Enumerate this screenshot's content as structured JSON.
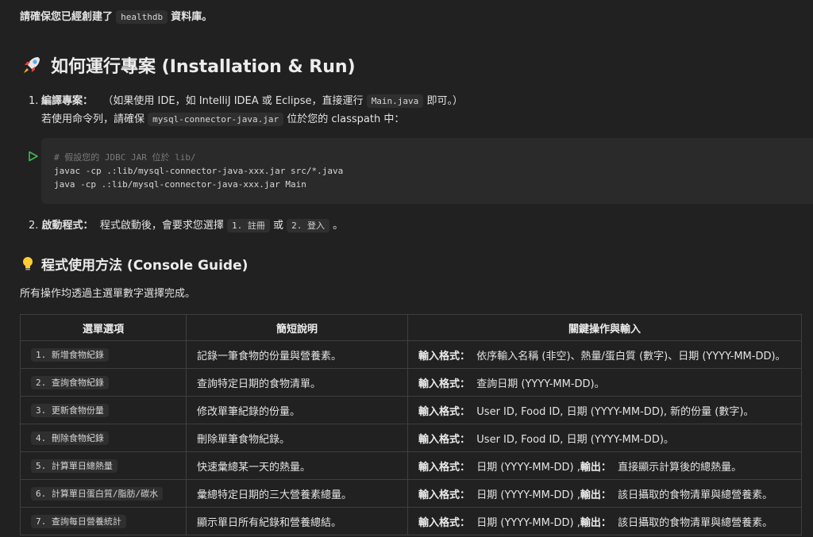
{
  "top": {
    "prefix": "請確保您已經創建了",
    "code": "healthdb",
    "suffix": "資料庫。"
  },
  "install": {
    "heading": "如何運行專案 (Installation & Run)",
    "icon": "rocket-icon",
    "step1": {
      "num": "1.",
      "label": "編譯專案：",
      "text_a": "（如果使用 IDE，如 IntelliJ IDEA 或 Eclipse，直接運行",
      "code_a": "Main.java",
      "text_b": "即可。）",
      "text_c": "若使用命令列，請確保",
      "code_b": "mysql-connector-java.jar",
      "text_d": "位於您的 classpath 中："
    },
    "code_block": {
      "comment": "# 假設您的 JDBC JAR 位於 lib/",
      "line1": "javac -cp .:lib/mysql-connector-java-xxx.jar src/*.java",
      "line2": "java -cp .:lib/mysql-connector-java-xxx.jar Main",
      "run_icon": "run-icon"
    },
    "step2": {
      "num": "2.",
      "label": "啟動程式：",
      "text_a": "程式啟動後，會要求您選擇",
      "code_a": "1. 註冊",
      "text_b": "或",
      "code_b": "2. 登入",
      "text_c": "。"
    }
  },
  "guide": {
    "heading": "程式使用方法 (Console Guide)",
    "icon": "lightbulb-icon",
    "desc": "所有操作均透過主選單數字選擇完成。",
    "headers": [
      "選單選項",
      "簡短說明",
      "關鍵操作與輸入"
    ],
    "rows": [
      {
        "option": "1. 新增食物紀錄",
        "desc": "記錄一筆食物的份量與營養素。",
        "in_label": "輸入格式：",
        "in_text": "依序輸入名稱 (非空)、熱量/蛋白質 (數字)、日期 (YYYY-MM-DD)。",
        "out_label": "",
        "out_text": ""
      },
      {
        "option": "2. 查詢食物紀錄",
        "desc": "查詢特定日期的食物清單。",
        "in_label": "輸入格式：",
        "in_text": "查詢日期 (YYYY-MM-DD)。",
        "out_label": "",
        "out_text": ""
      },
      {
        "option": "3. 更新食物份量",
        "desc": "修改單筆紀錄的份量。",
        "in_label": "輸入格式：",
        "in_text": "User ID, Food ID, 日期 (YYYY-MM-DD), 新的份量 (數字)。",
        "out_label": "",
        "out_text": ""
      },
      {
        "option": "4. 刪除食物紀錄",
        "desc": "刪除單筆食物紀錄。",
        "in_label": "輸入格式：",
        "in_text": "User ID, Food ID, 日期 (YYYY-MM-DD)。",
        "out_label": "",
        "out_text": ""
      },
      {
        "option": "5. 計算單日總熱量",
        "desc": "快速彙總某一天的熱量。",
        "in_label": "輸入格式：",
        "in_text": "日期 (YYYY-MM-DD) ,",
        "out_label": "輸出：",
        "out_text": "直接顯示計算後的總熱量。"
      },
      {
        "option": "6. 計算單日蛋白質/脂肪/碳水",
        "desc": "彙總特定日期的三大營養素總量。",
        "in_label": "輸入格式：",
        "in_text": "日期 (YYYY-MM-DD) ,",
        "out_label": "輸出：",
        "out_text": "該日攝取的食物清單與總營養素。"
      },
      {
        "option": "7. 查詢每日營養統計",
        "desc": "顯示單日所有紀錄和營養總結。",
        "in_label": "輸入格式：",
        "in_text": "日期 (YYYY-MM-DD) ,",
        "out_label": "輸出：",
        "out_text": "該日攝取的食物清單與總營養素。"
      }
    ]
  }
}
